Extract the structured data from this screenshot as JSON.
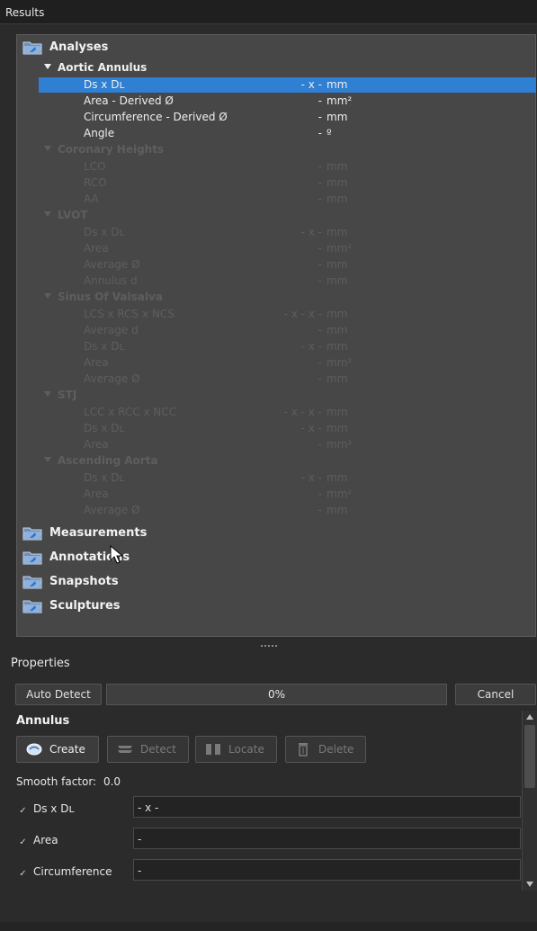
{
  "panel": {
    "title": "Results"
  },
  "tree": {
    "folders": [
      {
        "label": "Analyses",
        "icon": "folder-icon"
      },
      {
        "label": "Measurements",
        "icon": "folder-icon"
      },
      {
        "label": "Annotations",
        "icon": "folder-icon"
      },
      {
        "label": "Snapshots",
        "icon": "folder-icon"
      },
      {
        "label": "Sculptures",
        "icon": "folder-icon"
      }
    ],
    "categories": [
      {
        "label": "Aortic Annulus",
        "enabled": true
      },
      {
        "label": "Coronary Heights",
        "enabled": false
      },
      {
        "label": "LVOT",
        "enabled": false
      },
      {
        "label": "Sinus Of Valsalva",
        "enabled": false
      },
      {
        "label": "STJ",
        "enabled": false
      },
      {
        "label": "Ascending Aorta",
        "enabled": false
      }
    ],
    "rows": [
      {
        "name": "Ds x Dʟ",
        "value": "- x -",
        "unit": "mm",
        "selected": true
      },
      {
        "name": "Area - Derived Ø",
        "value": "-",
        "unit": "mm²"
      },
      {
        "name": "Circumference - Derived Ø",
        "value": "-",
        "unit": "mm"
      },
      {
        "name": "Angle",
        "value": "-",
        "unit": "º"
      },
      {
        "name": "LCO",
        "value": "-",
        "unit": "mm"
      },
      {
        "name": "RCO",
        "value": "-",
        "unit": "mm"
      },
      {
        "name": "AA",
        "value": "-",
        "unit": "mm"
      },
      {
        "name": "Ds x Dʟ",
        "value": "- x -",
        "unit": "mm"
      },
      {
        "name": "Area",
        "value": "-",
        "unit": "mm²"
      },
      {
        "name": "Average Ø",
        "value": "-",
        "unit": "mm"
      },
      {
        "name": "Annulus d",
        "value": "-",
        "unit": "mm"
      },
      {
        "name": "LCS x RCS x NCS",
        "value": "- x - x -",
        "unit": "mm"
      },
      {
        "name": "Average d",
        "value": "-",
        "unit": "mm"
      },
      {
        "name": "Ds x Dʟ",
        "value": "- x -",
        "unit": "mm"
      },
      {
        "name": "Area",
        "value": "-",
        "unit": "mm²"
      },
      {
        "name": "Average Ø",
        "value": "-",
        "unit": "mm"
      },
      {
        "name": "LCC x RCC x NCC",
        "value": "- x - x -",
        "unit": "mm"
      },
      {
        "name": "Ds x Dʟ",
        "value": "- x -",
        "unit": "mm"
      },
      {
        "name": "Area",
        "value": "-",
        "unit": "mm²"
      },
      {
        "name": "Ds x Dʟ",
        "value": "- x -",
        "unit": "mm"
      },
      {
        "name": "Area",
        "value": "-",
        "unit": "mm²"
      },
      {
        "name": "Average Ø",
        "value": "-",
        "unit": "mm"
      }
    ]
  },
  "properties": {
    "title": "Properties",
    "auto_detect": "Auto Detect",
    "progress_text": "0%",
    "progress": 0,
    "cancel": "Cancel",
    "section": "Annulus",
    "create": "Create",
    "detect": "Detect",
    "locate": "Locate",
    "delete": "Delete",
    "smooth_label": "Smooth factor:",
    "smooth_value": "0.0",
    "checks": [
      {
        "label": "Ds x Dʟ",
        "value": "- x -"
      },
      {
        "label": "Area",
        "value": "-"
      },
      {
        "label": "Circumference",
        "value": "-"
      }
    ]
  },
  "colors": {
    "selection": "#2f7fd2",
    "panel": "#474747",
    "background": "#2b2b2b"
  }
}
